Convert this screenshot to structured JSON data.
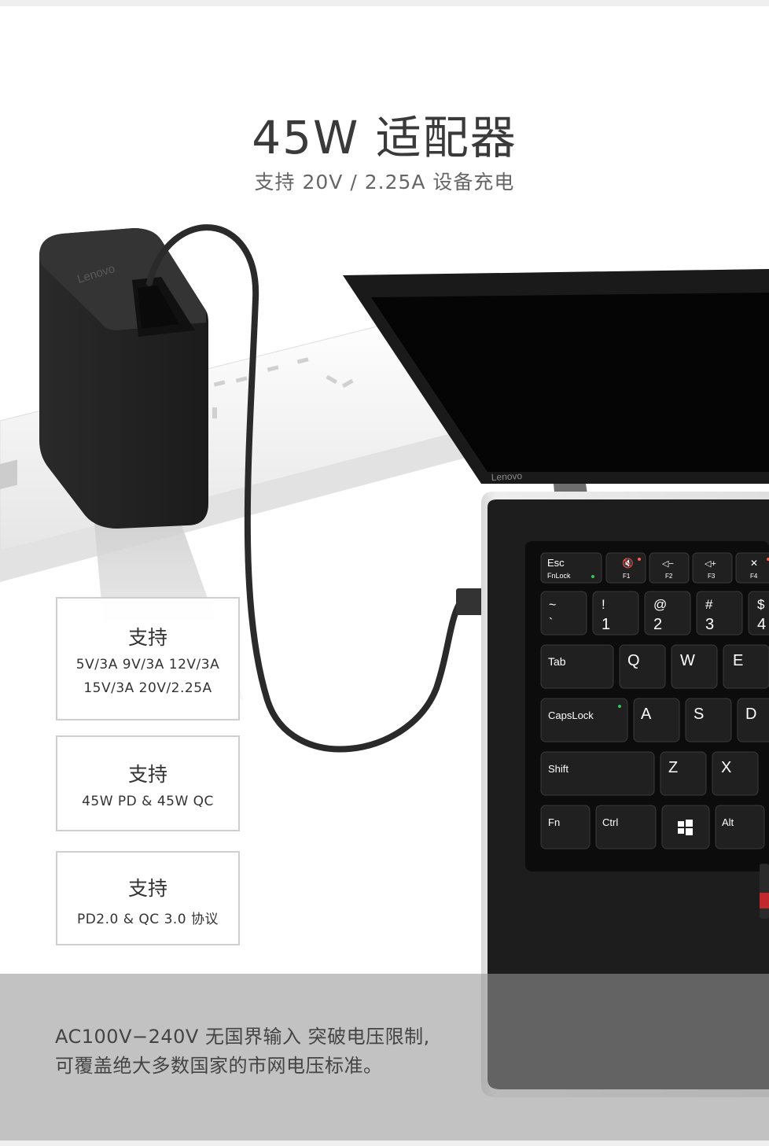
{
  "header": {
    "title": "45W 适配器",
    "subtitle": "支持 20V / 2.25A 设备充电"
  },
  "features": [
    {
      "heading": "支持",
      "lines": [
        "5V/3A  9V/3A 12V/3A",
        "15V/3A 20V/2.25A"
      ]
    },
    {
      "heading": "支持",
      "lines": [
        "45W PD & 45W QC"
      ]
    },
    {
      "heading": "支持",
      "lines": [
        "PD2.0 & QC 3.0 协议"
      ]
    }
  ],
  "footer": {
    "line1": "AC100V−240V 无国界输入 突破电压限制,",
    "line2": "可覆盖绝大多数国家的市网电压标准。"
  },
  "product": {
    "charger_brand": "Lenovo",
    "laptop_brand": "Lenovo"
  },
  "keyboard": {
    "esc": "Esc",
    "fnlock": "FnLock",
    "f1": "F1",
    "f2": "F2",
    "f3": "F3",
    "f4": "F4",
    "row_num": [
      [
        "~",
        "`"
      ],
      [
        "!",
        "1"
      ],
      [
        "@",
        "2"
      ],
      [
        "#",
        "3"
      ],
      [
        "$",
        "4"
      ]
    ],
    "tab": "Tab",
    "q": "Q",
    "w": "W",
    "e": "E",
    "capslock": "CapsLock",
    "a": "A",
    "s": "S",
    "d": "D",
    "shift": "Shift",
    "z": "Z",
    "x": "X",
    "fn": "Fn",
    "ctrl": "Ctrl",
    "alt": "Alt"
  }
}
